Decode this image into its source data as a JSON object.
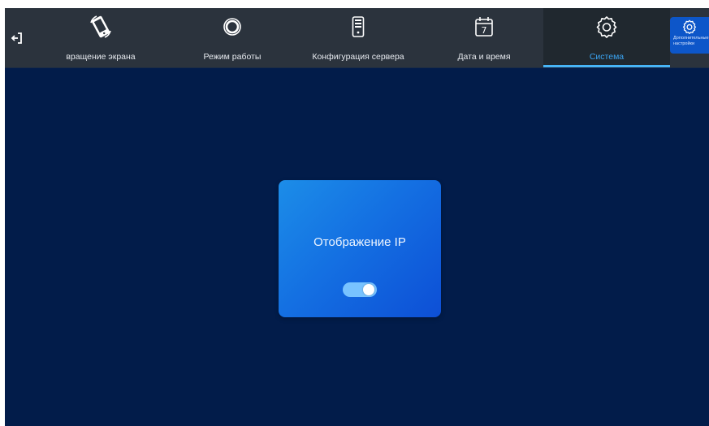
{
  "topbar": {
    "back_icon": "exit-arrow-icon",
    "tabs": [
      {
        "label": "вращение экрана",
        "icon": "screen-rotation-icon",
        "active": false
      },
      {
        "label": "Режим работы",
        "icon": "ring-icon",
        "active": false
      },
      {
        "label": "Конфигурация сервера",
        "icon": "server-icon",
        "active": false
      },
      {
        "label": "Дата и время",
        "icon": "calendar-icon",
        "calendar_day": "7",
        "active": false
      },
      {
        "label": "Система",
        "icon": "gear-icon",
        "active": true
      }
    ],
    "extra": {
      "label": "Дополнительные настройки",
      "icon": "gear-icon"
    }
  },
  "main": {
    "card": {
      "title": "Отображение IP",
      "toggle_on": true
    }
  },
  "colors": {
    "background": "#021c4a",
    "topbar": "#2b333d",
    "accent": "#3aa4f2",
    "card_gradient_start": "#1c8de8",
    "card_gradient_end": "#0d4fd6",
    "extra_button": "#0d56c9"
  }
}
